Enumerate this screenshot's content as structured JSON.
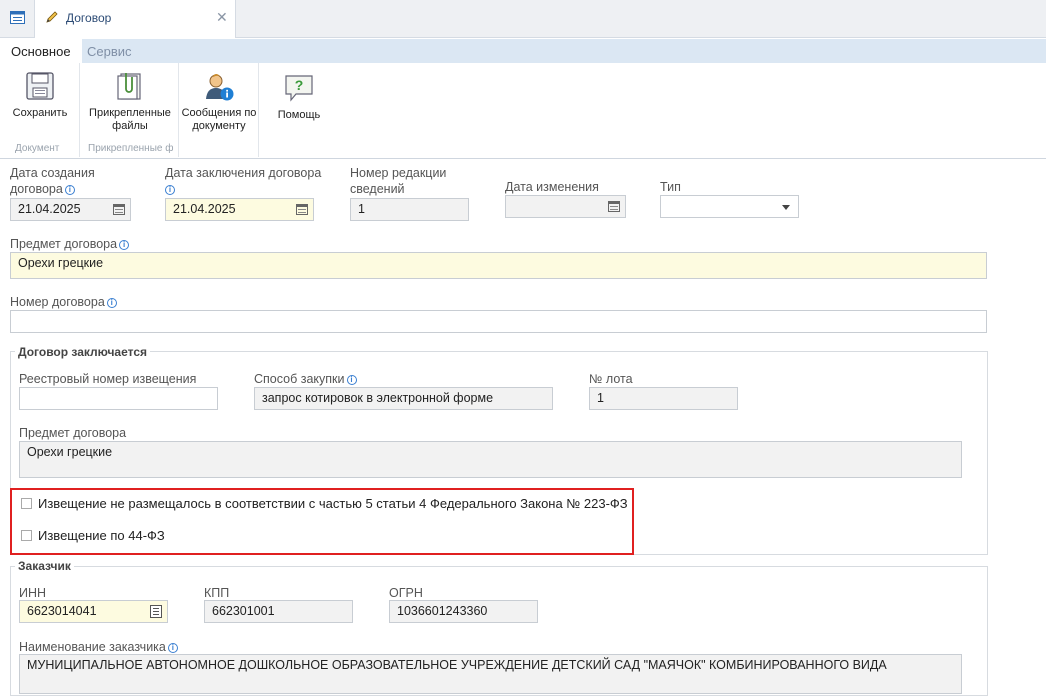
{
  "tab": {
    "title": "Договор",
    "close": "✕"
  },
  "ribbon": {
    "tabs": [
      "Основное",
      "Сервис"
    ],
    "save": "Сохранить",
    "attachments_1": "Прикрепленные",
    "attachments_2": "файлы",
    "messages_1": "Сообщения по",
    "messages_2": "документу",
    "help": "Помощь",
    "group_document": "Документ",
    "group_attached": "Прикрепленные ф"
  },
  "form": {
    "created_label_1": "Дата создания",
    "created_label_2": "договора",
    "created_value": "21.04.2025",
    "concluded_label": "Дата заключения договора",
    "concluded_value": "21.04.2025",
    "revision_label_1": "Номер редакции",
    "revision_label_2": "сведений",
    "revision_value": "1",
    "changed_label": "Дата изменения",
    "changed_value": "",
    "type_label": "Тип",
    "type_value": "",
    "subject_label": "Предмет договора",
    "subject_value": "Орехи грецкие",
    "number_label": "Номер договора",
    "number_value": ""
  },
  "concluded_section": {
    "legend": "Договор заключается",
    "registry_label": "Реестровый номер извещения",
    "registry_value": "",
    "method_label": "Способ закупки",
    "method_value": "запрос котировок в электронной форме",
    "lot_label": "№ лота",
    "lot_value": "1",
    "subject_label": "Предмет договора",
    "subject_value": "Орехи грецкие",
    "checkbox_1": "Извещение не размещалось в соответствии с частью 5 статьи 4 Федерального Закона № 223-ФЗ",
    "checkbox_2": "Извещение по 44-ФЗ"
  },
  "customer_section": {
    "legend": "Заказчик",
    "inn_label": "ИНН",
    "inn_value": "6623014041",
    "kpp_label": "КПП",
    "kpp_value": "662301001",
    "ogrn_label": "ОГРН",
    "ogrn_value": "1036601243360",
    "name_label": "Наименование заказчика",
    "name_value": "МУНИЦИПАЛЬНОЕ АВТОНОМНОЕ ДОШКОЛЬНОЕ ОБРАЗОВАТЕЛЬНОЕ УЧРЕЖДЕНИЕ  ДЕТСКИЙ САД \"МАЯЧОК\" КОМБИНИРОВАННОГО ВИДА"
  },
  "colors": {
    "accent": "#3a7fd1",
    "highlight_border": "#e02020",
    "yellow_field": "#fdfbe0"
  }
}
